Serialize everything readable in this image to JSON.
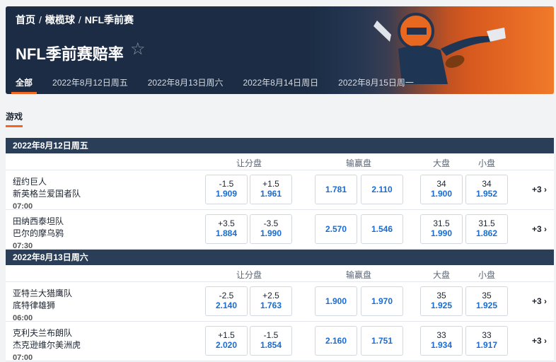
{
  "breadcrumb": [
    "首页",
    "橄榄球",
    "NFL季前赛"
  ],
  "title": "NFL季前赛赔率",
  "tabs": [
    "全部",
    "2022年8月12日周五",
    "2022年8月13日周六",
    "2022年8月14日周日",
    "2022年8月15日周一"
  ],
  "section_title": "游戏",
  "col_headers": {
    "spread": "让分盘",
    "moneyline": "输赢盘",
    "over": "大盘",
    "under": "小盘"
  },
  "days": [
    {
      "date": "2022年8月12日周五",
      "games": [
        {
          "home": "纽约巨人",
          "away": "新英格兰爱国者队",
          "time": "07:00",
          "spread": [
            {
              "line": "-1.5",
              "price": "1.909"
            },
            {
              "line": "+1.5",
              "price": "1.961"
            }
          ],
          "moneyline": [
            "1.781",
            "2.110"
          ],
          "total": [
            {
              "line": "34",
              "price": "1.900"
            },
            {
              "line": "34",
              "price": "1.952"
            }
          ],
          "more": "+3"
        },
        {
          "home": "田纳西泰坦队",
          "away": "巴尔的摩乌鸦",
          "time": "07:30",
          "spread": [
            {
              "line": "+3.5",
              "price": "1.884"
            },
            {
              "line": "-3.5",
              "price": "1.990"
            }
          ],
          "moneyline": [
            "2.570",
            "1.546"
          ],
          "total": [
            {
              "line": "31.5",
              "price": "1.990"
            },
            {
              "line": "31.5",
              "price": "1.862"
            }
          ],
          "more": "+3"
        }
      ]
    },
    {
      "date": "2022年8月13日周六",
      "games": [
        {
          "home": "亚特兰大猎鹰队",
          "away": "底特律雄狮",
          "time": "06:00",
          "spread": [
            {
              "line": "-2.5",
              "price": "2.140"
            },
            {
              "line": "+2.5",
              "price": "1.763"
            }
          ],
          "moneyline": [
            "1.900",
            "1.970"
          ],
          "total": [
            {
              "line": "35",
              "price": "1.925"
            },
            {
              "line": "35",
              "price": "1.925"
            }
          ],
          "more": "+3"
        },
        {
          "home": "克利夫兰布朗队",
          "away": "杰克逊维尔美洲虎",
          "time": "07:00",
          "spread": [
            {
              "line": "+1.5",
              "price": "2.020"
            },
            {
              "line": "-1.5",
              "price": "1.854"
            }
          ],
          "moneyline": [
            "2.160",
            "1.751"
          ],
          "total": [
            {
              "line": "33",
              "price": "1.934"
            },
            {
              "line": "33",
              "price": "1.917"
            }
          ],
          "more": "+3"
        }
      ]
    }
  ],
  "colors": {
    "accent": "#f26522",
    "header_bg": "#2b3e57",
    "price": "#1a6bd1"
  }
}
